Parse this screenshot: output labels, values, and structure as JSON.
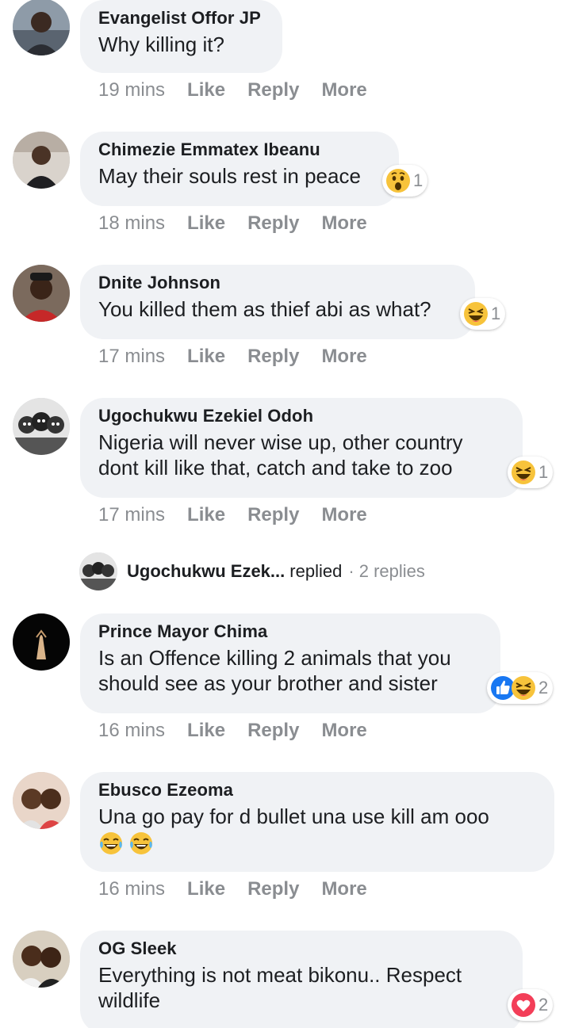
{
  "comments": [
    {
      "author": "Evangelist Offor JP",
      "text": "Why killing it?",
      "time": "19 mins",
      "reactions": null
    },
    {
      "author": "Chimezie Emmatex Ibeanu",
      "text": "May their souls rest in peace",
      "time": "18 mins",
      "reactions": {
        "icons": [
          "wow-emoji"
        ],
        "count": "1"
      }
    },
    {
      "author": "Dnite Johnson",
      "text": "You killed them as thief abi as what?",
      "time": "17 mins",
      "reactions": {
        "icons": [
          "haha-emoji"
        ],
        "count": "1"
      }
    },
    {
      "author": "Ugochukwu Ezekiel Odoh",
      "text": "Nigeria will never wise up, other country\ndont kill like that, catch and take to zoo",
      "time": "17 mins",
      "reactions": {
        "icons": [
          "haha-emoji"
        ],
        "count": "1"
      }
    },
    {
      "author": "Prince Mayor Chima",
      "text": "Is an Offence killing 2 animals that you\nshould see as your brother and sister",
      "time": "16 mins",
      "reactions": {
        "icons": [
          "like-emoji",
          "haha-emoji"
        ],
        "count": "2"
      }
    },
    {
      "author": "Ebusco Ezeoma",
      "text": "Una go pay for d bullet una use kill am ooo",
      "inline_emojis": [
        "tears-of-joy-emoji",
        "tears-of-joy-emoji"
      ],
      "time": "16 mins",
      "reactions": null
    },
    {
      "author": "OG Sleek",
      "text": "Everything is not meat bikonu.. Respect\nwildlife",
      "time": "",
      "reactions": {
        "icons": [
          "love-emoji"
        ],
        "count": "2"
      }
    }
  ],
  "actions": {
    "like": "Like",
    "reply": "Reply",
    "more": "More"
  },
  "reply_summary": {
    "name": "Ugochukwu Ezek...",
    "verb": "replied",
    "count": "· 2 replies"
  },
  "colors": {
    "bubble": "#f0f2f5",
    "meta": "#8a8d91",
    "text": "#1c1e21",
    "like_blue": "#1877f2",
    "love_red": "#f33e58",
    "emoji_yellow": "#f7c33b"
  }
}
